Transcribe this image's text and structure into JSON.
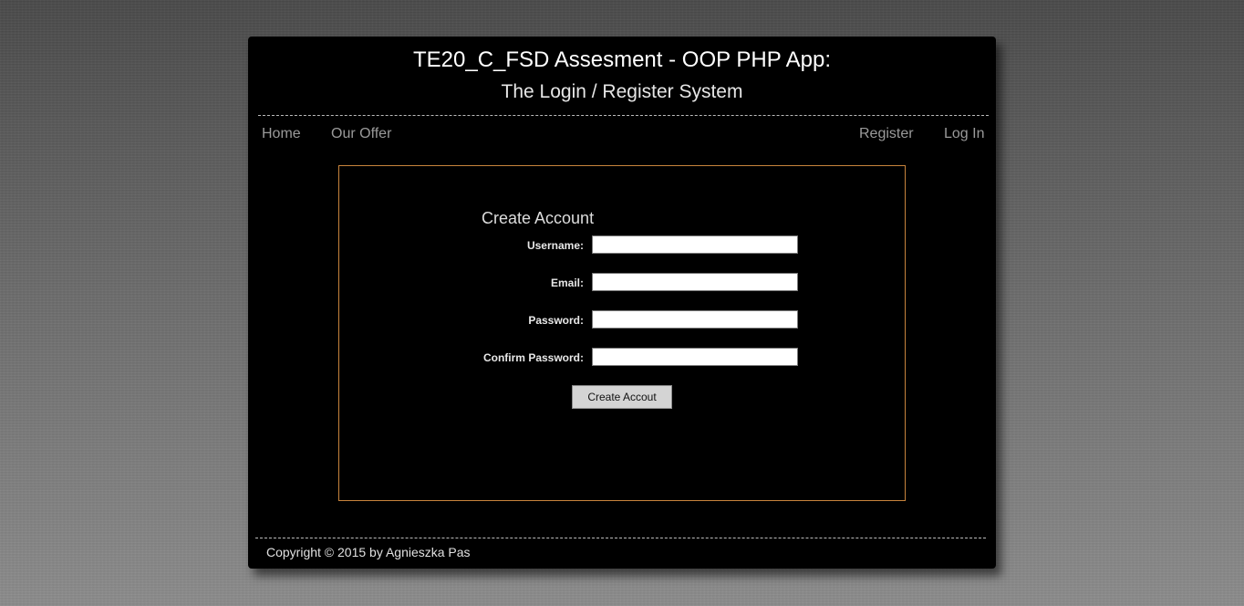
{
  "header": {
    "title": "TE20_C_FSD Assesment - OOP PHP App:",
    "subtitle": "The Login / Register System"
  },
  "nav": {
    "home": "Home",
    "our_offer": "Our Offer",
    "register": "Register",
    "login": "Log In"
  },
  "form": {
    "heading": "Create Account",
    "username_label": "Username:",
    "username_value": "",
    "email_label": "Email:",
    "email_value": "",
    "password_label": "Password:",
    "password_value": "",
    "confirm_label": "Confirm Password:",
    "confirm_value": "",
    "submit_label": "Create Accout"
  },
  "footer": {
    "copyright": "Copyright © 2015 by Agnieszka Pas"
  },
  "colors": {
    "panel_background": "#000000",
    "content_border": "#c8843c",
    "nav_link": "#9a9a9a",
    "button_background": "#d4d4d4"
  }
}
